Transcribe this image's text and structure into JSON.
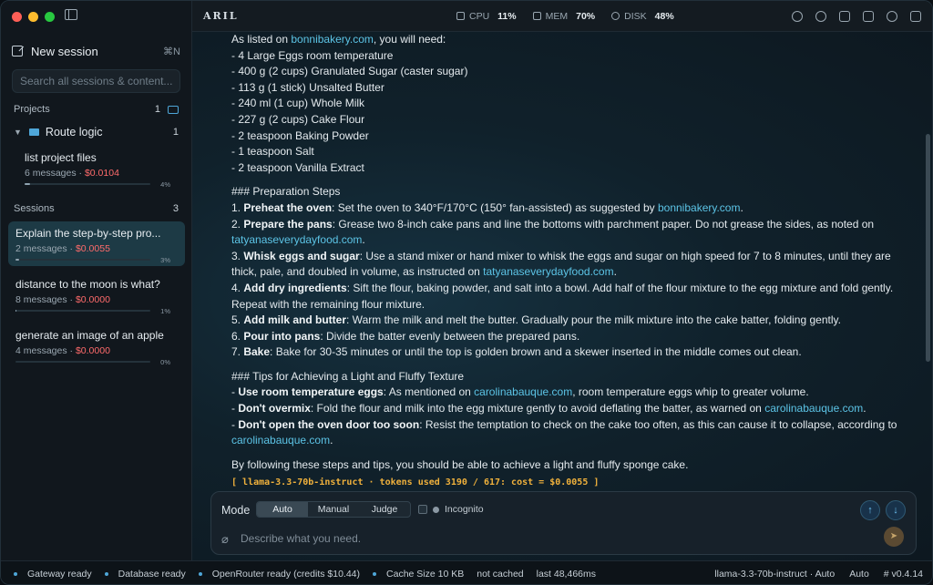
{
  "window": {
    "traffic_lights": [
      "#ff5f57",
      "#febc2e",
      "#28c840"
    ]
  },
  "sidebar": {
    "new_session": "New session",
    "new_session_shortcut": "⌘N",
    "search_placeholder": "Search all sessions & content...",
    "projects_label": "Projects",
    "projects_count": "1",
    "project": {
      "name": "Route logic",
      "count": "1"
    },
    "project_items": [
      {
        "title": "list project files",
        "messages": "6 messages · ",
        "cost": "$0.0104",
        "progress": 0.04,
        "pct": "4%"
      }
    ],
    "sessions_label": "Sessions",
    "sessions_count": "3",
    "sessions": [
      {
        "title": "Explain the step-by-step pro...",
        "messages": "2 messages · ",
        "cost": "$0.0055",
        "progress": 0.03,
        "pct": "3%"
      },
      {
        "title": "distance to the moon is what?",
        "messages": "8 messages · ",
        "cost": "$0.0000",
        "progress": 0.01,
        "pct": "1%"
      },
      {
        "title": "generate an image of an apple",
        "messages": "4 messages · ",
        "cost": "$0.0000",
        "progress": 0.0,
        "pct": "0%"
      }
    ]
  },
  "topbar": {
    "brand": "ARIL",
    "cpu_label": "CPU",
    "cpu_value": "11%",
    "mem_label": "MEM",
    "mem_value": "70%",
    "disk_label": "DISK",
    "disk_value": "48%",
    "icons": [
      "info-icon",
      "chat-icon",
      "bars-icon",
      "document-icon",
      "settings-icon",
      "exit-icon"
    ]
  },
  "content": {
    "intro_pre": "As listed on ",
    "intro_link": "bonnibakery.com",
    "intro_post": ", you will need:",
    "ingredients": [
      "- 4 Large Eggs room temperature",
      "- 400 g (2 cups) Granulated Sugar (caster sugar)",
      "- 113 g (1 stick) Unsalted Butter",
      "- 240 ml (1 cup) Whole Milk",
      "- 227 g (2 cups) Cake Flour",
      "- 2 teaspoon Baking Powder",
      "- 1 teaspoon Salt",
      "- 2 teaspoon Vanilla Extract"
    ],
    "prep_heading": "### Preparation Steps",
    "s1_num": "1. ",
    "s1_bold": "Preheat the oven",
    "s1_text": ": Set the oven to 340°F/170°C (150° fan-assisted) as suggested by ",
    "s1_link": "bonnibakery.com",
    "s1_end": ".",
    "s2_num": "2. ",
    "s2_bold": "Prepare the pans",
    "s2_text": ": Grease two 8-inch cake pans and line the bottoms with parchment paper. Do not grease the sides, as noted on ",
    "s2_link": "tatyanaseverydayfood.com",
    "s2_end": ".",
    "s3_num": "3. ",
    "s3_bold": "Whisk eggs and sugar",
    "s3_text": ": Use a stand mixer or hand mixer to whisk the eggs and sugar on high speed for 7 to 8 minutes, until they are thick, pale, and doubled in volume, as instructed on ",
    "s3_link": "tatyanaseverydayfood.com",
    "s3_end": ".",
    "s4_num": "4. ",
    "s4_bold": "Add dry ingredients",
    "s4_text": ": Sift the flour, baking powder, and salt into a bowl. Add half of the flour mixture to the egg mixture and fold gently. Repeat with the remaining flour mixture.",
    "s5_num": "5. ",
    "s5_bold": "Add milk and butter",
    "s5_text": ": Warm the milk and melt the butter. Gradually pour the milk mixture into the cake batter, folding gently.",
    "s6_num": "6. ",
    "s6_bold": "Pour into pans",
    "s6_text": ": Divide the batter evenly between the prepared pans.",
    "s7_num": "7. ",
    "s7_bold": "Bake",
    "s7_text": ": Bake for 30-35 minutes or until the top is golden brown and a skewer inserted in the middle comes out clean.",
    "tips_heading": "### Tips for Achieving a Light and Fluffy Texture",
    "t1_dash": "- ",
    "t1_bold": "Use room temperature eggs",
    "t1_text": ": As mentioned on ",
    "t1_link": "carolinabauque.com",
    "t1_end": ", room temperature eggs whip to greater volume.",
    "t2_dash": "- ",
    "t2_bold": "Don't overmix",
    "t2_text": ": Fold the flour and milk into the egg mixture gently to avoid deflating the batter, as warned on ",
    "t2_link": "carolinabauque.com",
    "t2_end": ".",
    "t3_dash": "- ",
    "t3_bold": "Don't open the oven door too soon",
    "t3_text": ": Resist the temptation to check on the cake too often, as this can cause it to collapse, according to ",
    "t3_link": "carolinabauque.com",
    "t3_end": ".",
    "closing": "By following these steps and tips, you should be able to achieve a light and fluffy sponge cake.",
    "llm_info": "[ llama-3.3-70b-instruct · tokens used 3190 / 617: cost = $0.0055 ]"
  },
  "composer": {
    "mode_label": "Mode",
    "modes": [
      "Auto",
      "Manual",
      "Judge"
    ],
    "selected_mode": "Auto",
    "incognito": "Incognito",
    "placeholder": "Describe what you need."
  },
  "statusbar": {
    "gateway": "Gateway ready",
    "database": "Database ready",
    "openrouter": "OpenRouter ready (credits $10.44)",
    "cache": "Cache Size 10 KB",
    "cached": "not cached",
    "last": "last 48,466ms",
    "model": "llama-3.3-70b-instruct · Auto",
    "auto": "Auto",
    "version": "# v0.4.14"
  },
  "colors": {
    "accent": "#4ea6d8",
    "link": "#5cc4e6",
    "cost": "#ff6b6b",
    "llm": "#f0b13c"
  }
}
